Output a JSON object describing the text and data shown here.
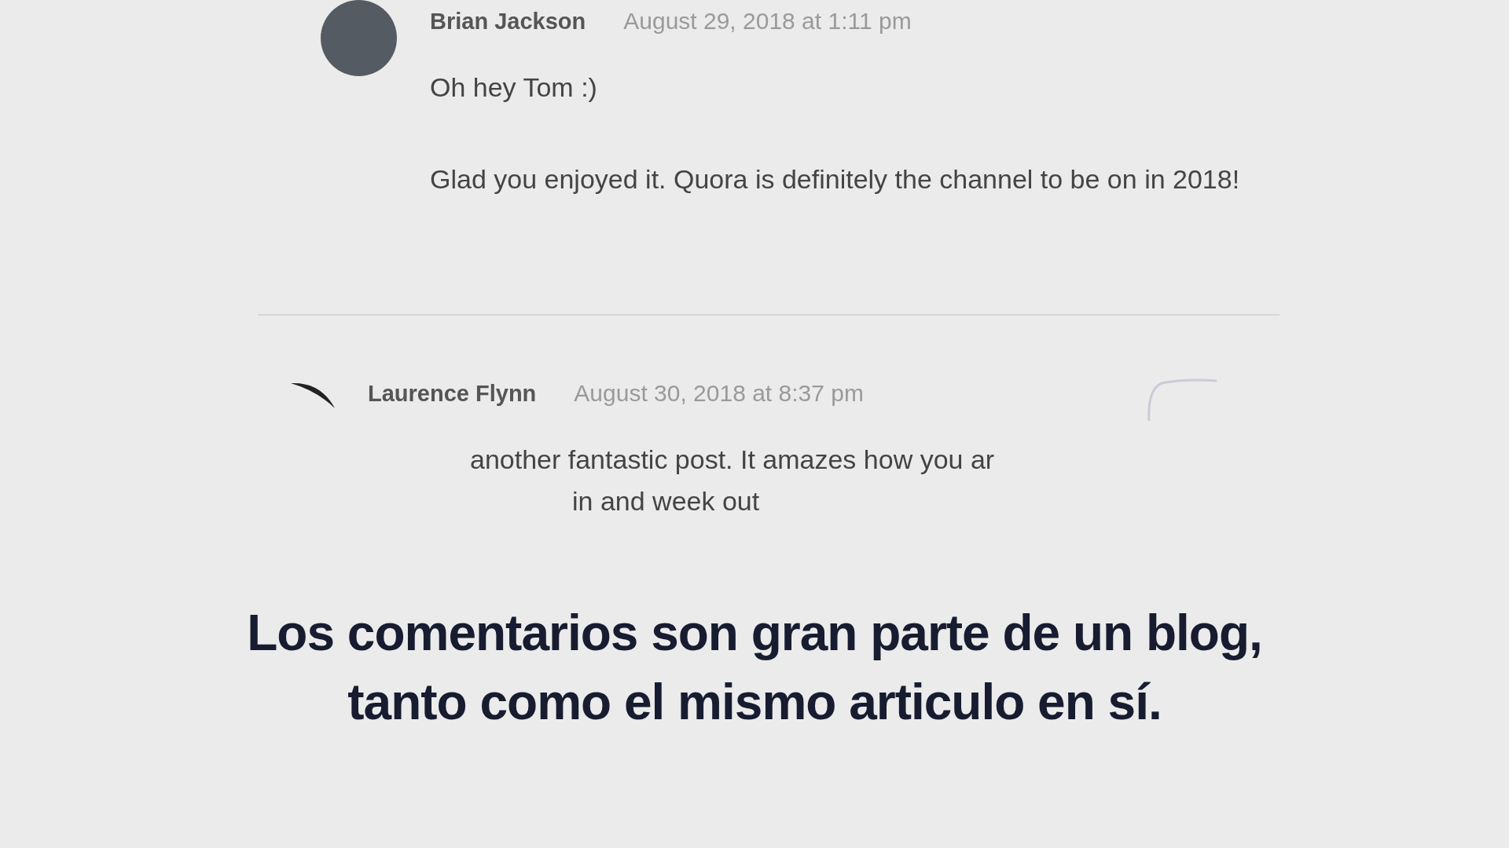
{
  "comments": [
    {
      "author": "Brian Jackson",
      "date": "August 29, 2018 at 1:11 pm",
      "paragraphs": [
        "Oh hey Tom :)",
        "Glad you enjoyed it. Quora is definitely the channel to be on in 2018!"
      ]
    },
    {
      "author": "Laurence Flynn",
      "date": "August 30, 2018 at 8:37 pm",
      "paragraphs": [
        "another fantastic post. It amazes how you ar",
        "in and week out"
      ]
    }
  ],
  "caption": [
    "Los comentarios son gran parte de un blog,",
    "tanto como el mismo articulo en sí."
  ]
}
